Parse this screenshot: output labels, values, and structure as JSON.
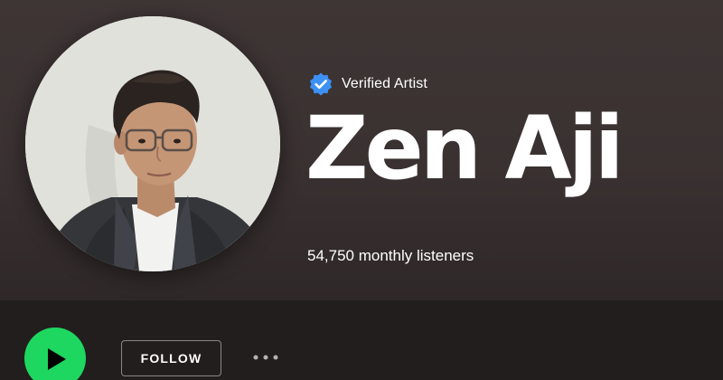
{
  "artist": {
    "verified_label": "Verified Artist",
    "name": "Zen Aji",
    "monthly_listeners": "54,750 monthly listeners"
  },
  "actions": {
    "follow_label": "FOLLOW"
  },
  "icons": {
    "verified": "verified-check-badge-icon",
    "play": "play-icon",
    "more": "more-options-icon"
  },
  "colors": {
    "accent_green": "#1ed760",
    "verified_blue": "#3d91f4",
    "hero_background": "#3e3535",
    "text": "#ffffff"
  }
}
